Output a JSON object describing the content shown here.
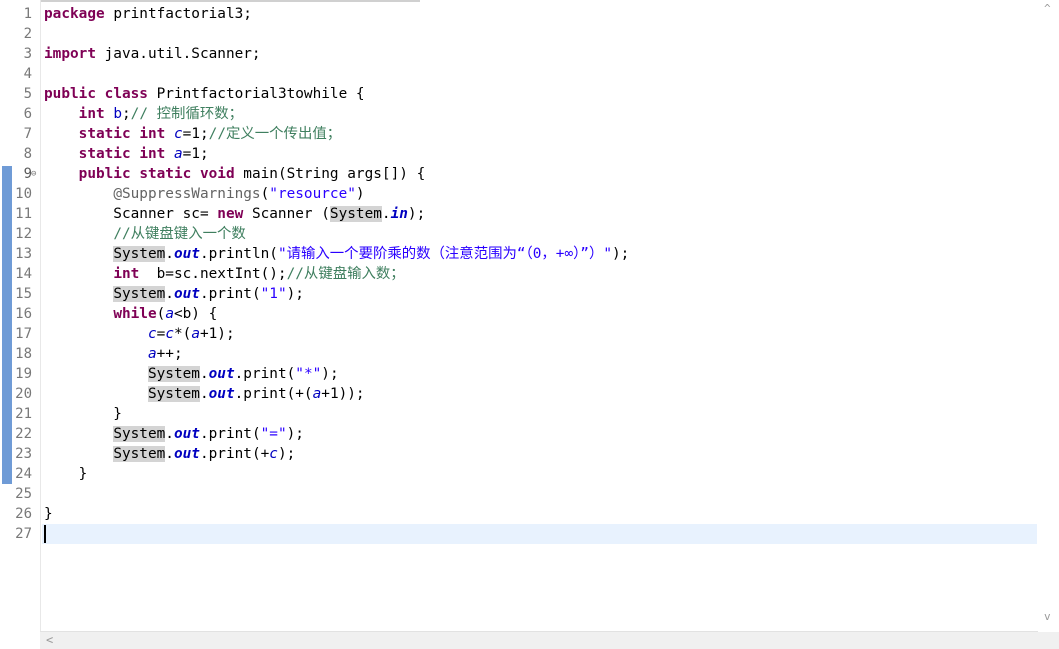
{
  "editor": {
    "lines": [
      {
        "n": "1",
        "segs": [
          {
            "t": "package",
            "c": "kw"
          },
          {
            "t": " printfactorial3;"
          }
        ]
      },
      {
        "n": "2",
        "segs": []
      },
      {
        "n": "3",
        "segs": [
          {
            "t": "import",
            "c": "kw"
          },
          {
            "t": " java.util.Scanner;"
          }
        ]
      },
      {
        "n": "4",
        "segs": []
      },
      {
        "n": "5",
        "segs": [
          {
            "t": "public",
            "c": "kw"
          },
          {
            "t": " "
          },
          {
            "t": "class",
            "c": "kw"
          },
          {
            "t": " Printfactorial3towhile {"
          }
        ]
      },
      {
        "n": "6",
        "segs": [
          {
            "t": "    "
          },
          {
            "t": "int",
            "c": "kw"
          },
          {
            "t": " "
          },
          {
            "t": "b",
            "c": "inst"
          },
          {
            "t": ";"
          },
          {
            "t": "// 控制循环数；",
            "c": "cm"
          }
        ]
      },
      {
        "n": "7",
        "segs": [
          {
            "t": "    "
          },
          {
            "t": "static",
            "c": "kw"
          },
          {
            "t": " "
          },
          {
            "t": "int",
            "c": "kw"
          },
          {
            "t": " "
          },
          {
            "t": "c",
            "c": "fld"
          },
          {
            "t": "=1;"
          },
          {
            "t": "//定义一个传出值；",
            "c": "cm"
          }
        ]
      },
      {
        "n": "8",
        "segs": [
          {
            "t": "    "
          },
          {
            "t": "static",
            "c": "kw"
          },
          {
            "t": " "
          },
          {
            "t": "int",
            "c": "kw"
          },
          {
            "t": " "
          },
          {
            "t": "a",
            "c": "fld"
          },
          {
            "t": "=1;"
          }
        ]
      },
      {
        "n": "9",
        "segs": [
          {
            "t": "    "
          },
          {
            "t": "public",
            "c": "kw"
          },
          {
            "t": " "
          },
          {
            "t": "static",
            "c": "kw"
          },
          {
            "t": " "
          },
          {
            "t": "void",
            "c": "kw"
          },
          {
            "t": " main(String args[]) {"
          }
        ]
      },
      {
        "n": "10",
        "segs": [
          {
            "t": "        "
          },
          {
            "t": "@SuppressWarnings",
            "c": "ann"
          },
          {
            "t": "("
          },
          {
            "t": "\"resource\"",
            "c": "str"
          },
          {
            "t": ")"
          }
        ]
      },
      {
        "n": "11",
        "segs": [
          {
            "t": "        Scanner sc= "
          },
          {
            "t": "new",
            "c": "kw"
          },
          {
            "t": " Scanner ("
          },
          {
            "t": "System",
            "c": "hl"
          },
          {
            "t": "."
          },
          {
            "t": "in",
            "c": "sfld"
          },
          {
            "t": ");"
          }
        ]
      },
      {
        "n": "12",
        "segs": [
          {
            "t": "        "
          },
          {
            "t": "//从键盘键入一个数",
            "c": "cm"
          }
        ]
      },
      {
        "n": "13",
        "segs": [
          {
            "t": "        "
          },
          {
            "t": "System",
            "c": "hl"
          },
          {
            "t": "."
          },
          {
            "t": "out",
            "c": "sfld"
          },
          {
            "t": ".println("
          },
          {
            "t": "\"请输入一个要阶乘的数（注意范围为“（0，+∞）”）\"",
            "c": "str"
          },
          {
            "t": ");"
          }
        ]
      },
      {
        "n": "14",
        "segs": [
          {
            "t": "        "
          },
          {
            "t": "int",
            "c": "kw"
          },
          {
            "t": "  b=sc.nextInt();"
          },
          {
            "t": "//从键盘输入数；",
            "c": "cm"
          }
        ]
      },
      {
        "n": "15",
        "segs": [
          {
            "t": "        "
          },
          {
            "t": "System",
            "c": "hl"
          },
          {
            "t": "."
          },
          {
            "t": "out",
            "c": "sfld"
          },
          {
            "t": ".print("
          },
          {
            "t": "\"1\"",
            "c": "str"
          },
          {
            "t": ");"
          }
        ]
      },
      {
        "n": "16",
        "segs": [
          {
            "t": "        "
          },
          {
            "t": "while",
            "c": "kw"
          },
          {
            "t": "("
          },
          {
            "t": "a",
            "c": "fld"
          },
          {
            "t": "<b) {"
          }
        ]
      },
      {
        "n": "17",
        "segs": [
          {
            "t": "            "
          },
          {
            "t": "c",
            "c": "fld"
          },
          {
            "t": "="
          },
          {
            "t": "c",
            "c": "fld"
          },
          {
            "t": "*("
          },
          {
            "t": "a",
            "c": "fld"
          },
          {
            "t": "+1);"
          }
        ]
      },
      {
        "n": "18",
        "segs": [
          {
            "t": "            "
          },
          {
            "t": "a",
            "c": "fld"
          },
          {
            "t": "++;"
          }
        ]
      },
      {
        "n": "19",
        "segs": [
          {
            "t": "            "
          },
          {
            "t": "System",
            "c": "hl"
          },
          {
            "t": "."
          },
          {
            "t": "out",
            "c": "sfld"
          },
          {
            "t": ".print("
          },
          {
            "t": "\"*\"",
            "c": "str"
          },
          {
            "t": ");"
          }
        ]
      },
      {
        "n": "20",
        "segs": [
          {
            "t": "            "
          },
          {
            "t": "System",
            "c": "hl"
          },
          {
            "t": "."
          },
          {
            "t": "out",
            "c": "sfld"
          },
          {
            "t": ".print(+("
          },
          {
            "t": "a",
            "c": "fld"
          },
          {
            "t": "+1));"
          }
        ]
      },
      {
        "n": "21",
        "segs": [
          {
            "t": "        }"
          }
        ]
      },
      {
        "n": "22",
        "segs": [
          {
            "t": "        "
          },
          {
            "t": "System",
            "c": "hl"
          },
          {
            "t": "."
          },
          {
            "t": "out",
            "c": "sfld"
          },
          {
            "t": ".print("
          },
          {
            "t": "\"=\"",
            "c": "str"
          },
          {
            "t": ");"
          }
        ]
      },
      {
        "n": "23",
        "segs": [
          {
            "t": "        "
          },
          {
            "t": "System",
            "c": "hl"
          },
          {
            "t": "."
          },
          {
            "t": "out",
            "c": "sfld"
          },
          {
            "t": ".print(+"
          },
          {
            "t": "c",
            "c": "fld"
          },
          {
            "t": ");"
          }
        ]
      },
      {
        "n": "24",
        "segs": [
          {
            "t": "    }"
          }
        ]
      },
      {
        "n": "25",
        "segs": []
      },
      {
        "n": "26",
        "segs": [
          {
            "t": "}"
          }
        ]
      },
      {
        "n": "27",
        "segs": []
      }
    ],
    "fold_marker": "⊖",
    "scroll_up_arrow": "^",
    "scroll_down_arrow": "v",
    "scroll_left_arrow": "<"
  },
  "colors": {
    "keyword": "#7f0055",
    "comment": "#3f7f5f",
    "string": "#2a00ff",
    "field": "#0000c0",
    "current_line": "#e8f2fe",
    "change_bar": "#6f9bd6"
  }
}
